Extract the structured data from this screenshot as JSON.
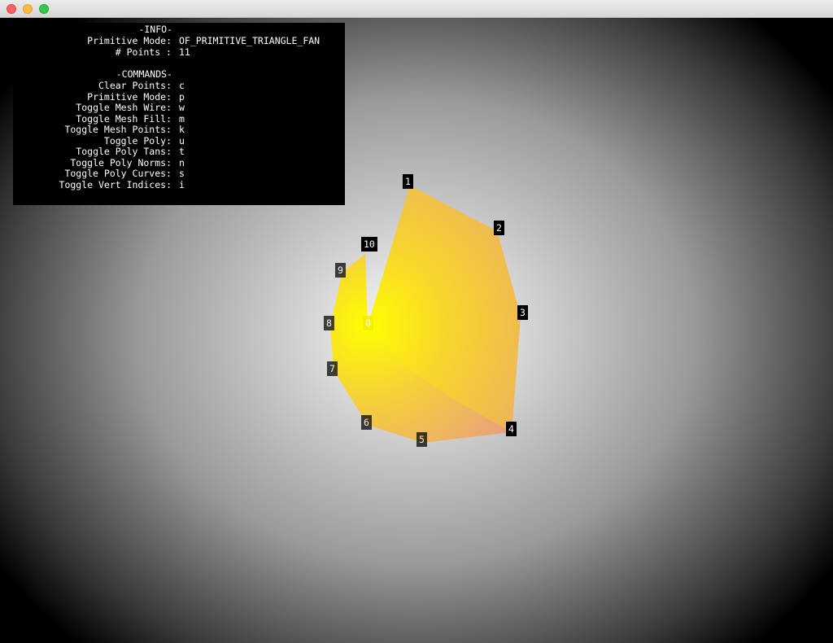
{
  "window": {
    "traffic_lights": [
      "close",
      "minimize",
      "zoom"
    ]
  },
  "info": {
    "header": "-INFO-",
    "rows": [
      {
        "label": "Primitive Mode:",
        "value": "OF_PRIMITIVE_TRIANGLE_FAN"
      },
      {
        "label": "# Points :",
        "value": "11"
      }
    ]
  },
  "commands": {
    "header": "-COMMANDS-",
    "rows": [
      {
        "label": "Clear Points:",
        "value": "c"
      },
      {
        "label": "Primitive Mode:",
        "value": "p"
      },
      {
        "label": "Toggle Mesh Wire:",
        "value": "w"
      },
      {
        "label": "Toggle Mesh Fill:",
        "value": "m"
      },
      {
        "label": "Toggle Mesh Points:",
        "value": "k"
      },
      {
        "label": "Toggle Poly:",
        "value": "u"
      },
      {
        "label": "Toggle Poly Tans:",
        "value": "t"
      },
      {
        "label": "Toggle Poly Norms:",
        "value": "n"
      },
      {
        "label": "Toggle Poly Curves:",
        "value": "s"
      },
      {
        "label": "Toggle Vert Indices:",
        "value": "i"
      }
    ]
  },
  "mesh": {
    "fill_colors": {
      "center": "#ffff00",
      "mid": "#f2c84a",
      "outer": "#eaa27a"
    },
    "vertex_labels": [
      "0",
      "1",
      "2",
      "3",
      "4",
      "5",
      "6",
      "7",
      "8",
      "9",
      "10"
    ]
  }
}
